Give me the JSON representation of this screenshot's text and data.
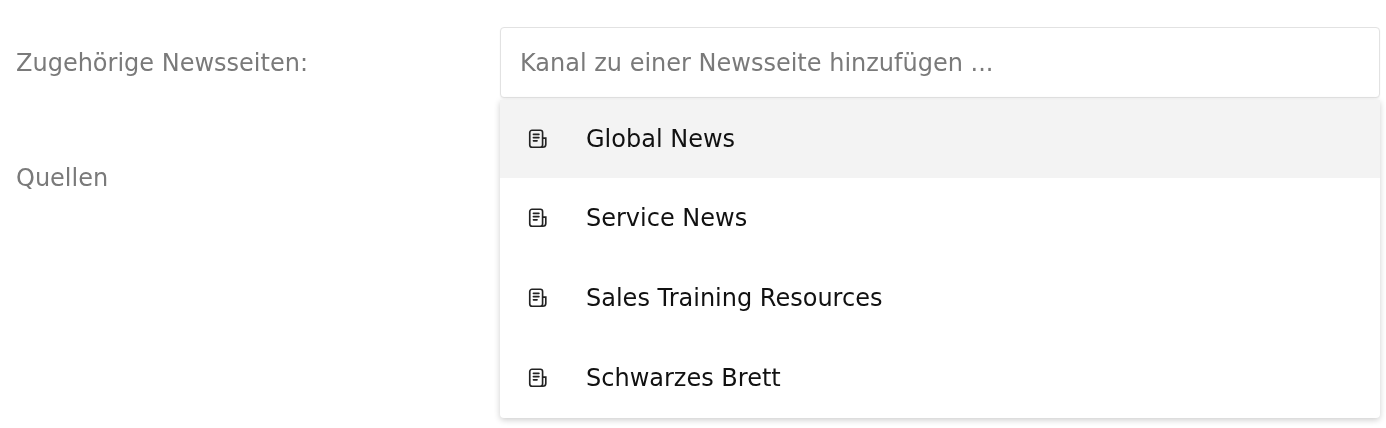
{
  "form": {
    "rows": [
      {
        "label": "Zugehörige Newsseiten:"
      },
      {
        "label": "Quellen"
      }
    ]
  },
  "news_field": {
    "placeholder": "Kanal zu einer Newsseite hinzufügen ..."
  },
  "dropdown": {
    "items": [
      {
        "label": "Global News",
        "selected": true
      },
      {
        "label": "Service News",
        "selected": false
      },
      {
        "label": "Sales Training Resources",
        "selected": false
      },
      {
        "label": "Schwarzes Brett",
        "selected": false
      }
    ]
  }
}
